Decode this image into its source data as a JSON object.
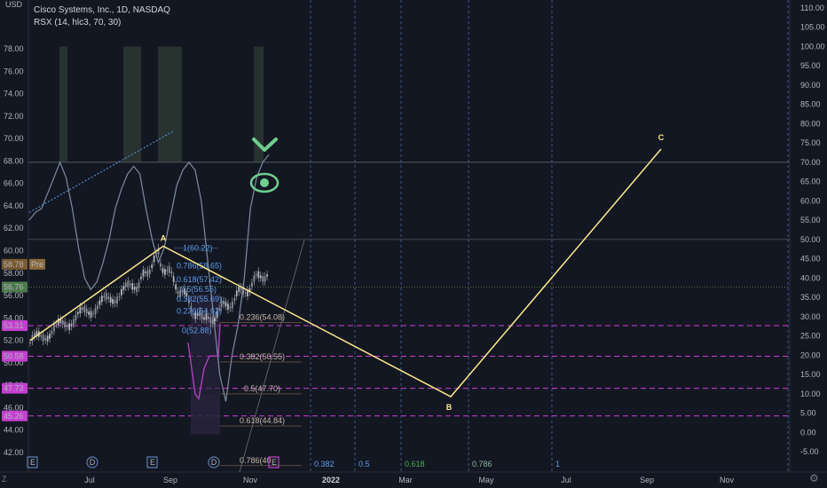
{
  "header": {
    "title": "Cisco Systems, Inc., 1D, NASDAQ",
    "indicator": "RSX (14, hlc3, 70, 30)",
    "currency": "USD"
  },
  "colors": {
    "background": "#131722",
    "wave_line": "#ffe98a",
    "fib_label": "#5d9cec",
    "magenta": "#d13ddb",
    "green_badge": "#4c7a4c",
    "rsx_line": "#7e8ca3",
    "candle": "#b2b5be",
    "icon_green": "#6ecf8f"
  },
  "chart_data": {
    "type": "line",
    "left_axis": {
      "ticks": [
        "78.00",
        "76.00",
        "74.00",
        "72.00",
        "70.00",
        "68.00",
        "66.00",
        "64.00",
        "62.00",
        "60.00",
        "58.00",
        "56.00",
        "54.00",
        "52.00",
        "50.00",
        "48.00",
        "46.00",
        "44.00",
        "42.00"
      ],
      "range": [
        41.0,
        79.0
      ]
    },
    "right_axis": {
      "ticks": [
        "110.00",
        "105.00",
        "100.00",
        "95.00",
        "90.00",
        "85.00",
        "80.00",
        "75.00",
        "70.00",
        "65.00",
        "60.00",
        "55.00",
        "50.00",
        "45.00",
        "40.00",
        "35.00",
        "30.00",
        "25.00",
        "20.00",
        "15.00",
        "10.00",
        "5.00",
        "0.00",
        "-5.00"
      ],
      "range": [
        -7,
        112
      ]
    },
    "x_ticks": [
      "Jul",
      "Sep",
      "Nov",
      "2022",
      "Mar",
      "May",
      "Jul",
      "Sep",
      "Nov"
    ],
    "price_badges": [
      {
        "label": "58.78",
        "price": 58.78,
        "color": "#7a5a30",
        "text": "Pre"
      },
      {
        "label": "56.76",
        "price": 56.76,
        "color": "#4c7a4c"
      },
      {
        "label": "53.31",
        "price": 53.31,
        "color": "#c43fd0"
      },
      {
        "label": "50.58",
        "price": 50.58,
        "color": "#c43fd0"
      },
      {
        "label": "47.73",
        "price": 47.73,
        "color": "#c43fd0"
      },
      {
        "label": "45.26",
        "price": 45.26,
        "color": "#c43fd0"
      }
    ],
    "waves": [
      {
        "label": "A",
        "price": 60.4
      },
      {
        "label": "B",
        "price": 47.3
      },
      {
        "label": "C",
        "price": 66.7
      }
    ],
    "fib_retracement_upper": [
      {
        "text": "1(60.22)"
      },
      {
        "text": "0.786(58.65)"
      },
      {
        "text": "0.618(57.42)"
      },
      {
        "text": "0.5(56.55)"
      },
      {
        "text": "0.382(55.69)"
      },
      {
        "text": "0.236(54.62)"
      },
      {
        "text": "0(52.88)"
      }
    ],
    "fib_extension_lower": [
      {
        "text": "0.236(54.08)"
      },
      {
        "text": "0.382(50.55)"
      },
      {
        "text": "0.5(47.70)"
      },
      {
        "text": "0.618(44.84)"
      },
      {
        "text": "0.786(40"
      }
    ],
    "time_fib": [
      "0.382",
      "0.5",
      "0.618",
      "0.786",
      "1"
    ],
    "horizontal_levels": [
      70,
      50,
      30,
      20,
      10,
      4
    ],
    "rsx_series": [
      55,
      57,
      58,
      62,
      66,
      70,
      66,
      58,
      48,
      40,
      37,
      39,
      44,
      50,
      58,
      63,
      67,
      69,
      67,
      58,
      50,
      44,
      48,
      56,
      64,
      68,
      70,
      68,
      60,
      45,
      30,
      15,
      8,
      20,
      28,
      40,
      58,
      66,
      70,
      72
    ]
  },
  "markers": [
    "E",
    "D",
    "E",
    "D",
    "E"
  ],
  "icons": [
    "check-icon",
    "eye-icon"
  ],
  "settings_icon": "gear-icon"
}
